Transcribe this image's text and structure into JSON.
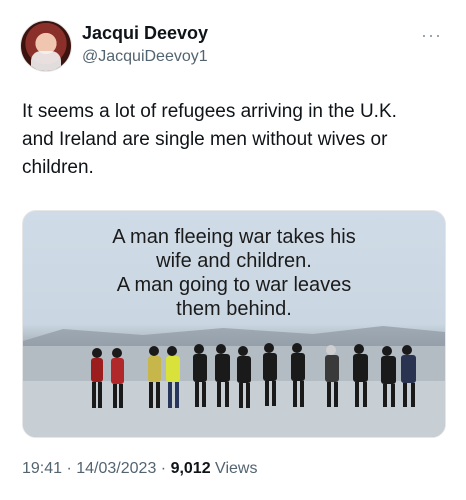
{
  "author": {
    "name": "Jacqui Deevoy",
    "handle": "@JacquiDeevoy1"
  },
  "tweet": {
    "text": "It seems a lot of refugees arriving in the U.K.\nand Ireland are single men without wives or\nchildren."
  },
  "media": {
    "overlay_text": "A man fleeing war takes his\nwife and children.\nA man going to war leaves\nthem behind."
  },
  "meta": {
    "timestamp": "19:41 · 14/03/2023 · ",
    "views_count": "9,012",
    "views_label": " Views"
  },
  "icons": {
    "more": "more-horizontal-icon"
  }
}
